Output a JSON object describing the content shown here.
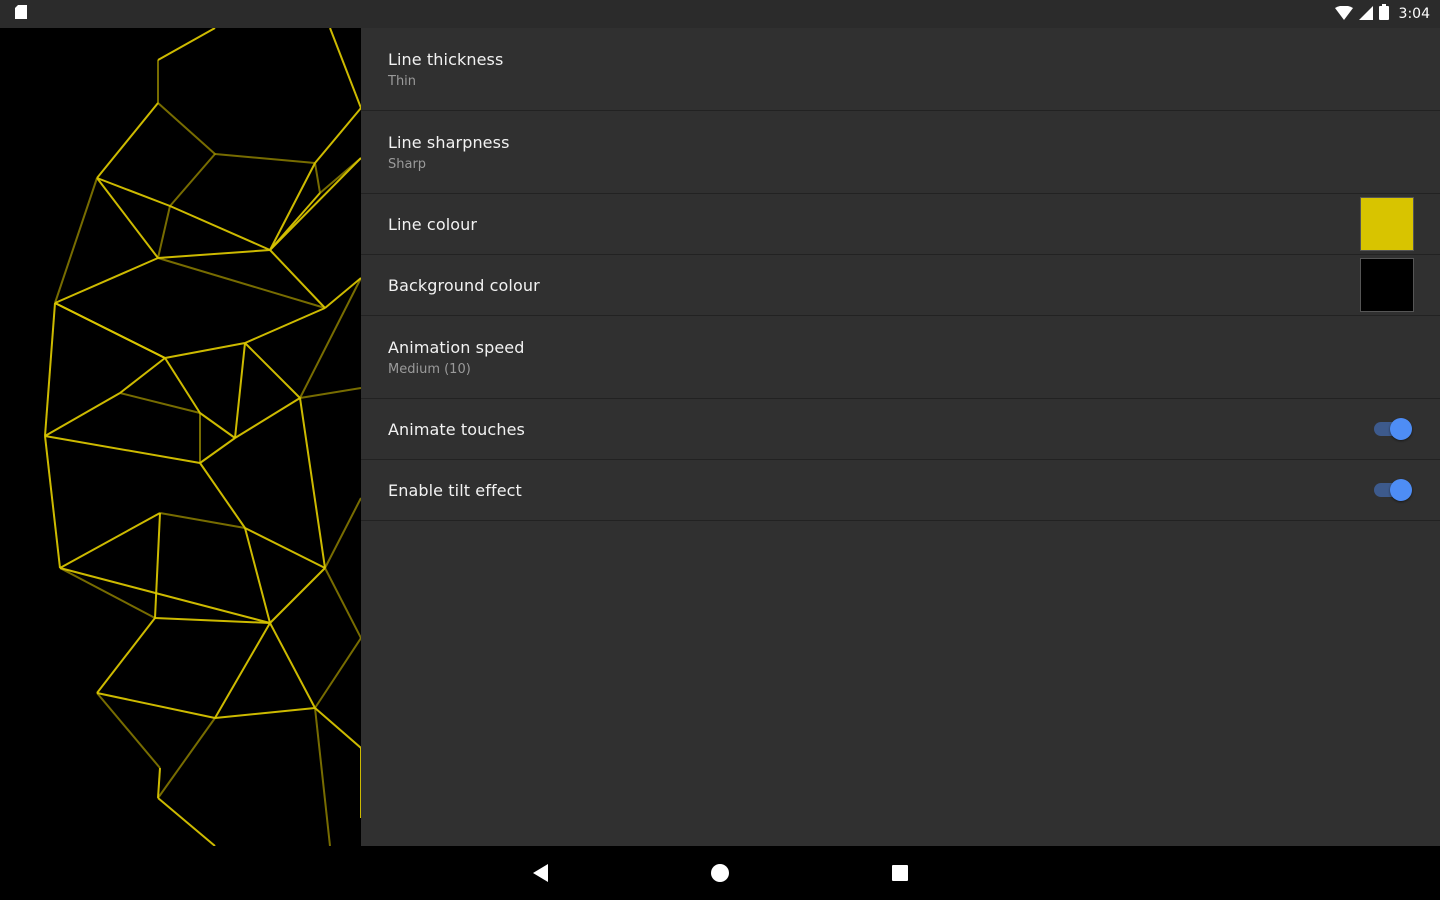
{
  "status_bar": {
    "time": "3:04",
    "icons": [
      "sd-card-icon",
      "wifi-icon",
      "cell-signal-icon",
      "battery-icon"
    ]
  },
  "preview": {
    "line_color": "#d8c400",
    "background_color": "#000000"
  },
  "settings": {
    "items": [
      {
        "title": "Line thickness",
        "summary": "Thin"
      },
      {
        "title": "Line sharpness",
        "summary": "Sharp"
      },
      {
        "title": "Line colour",
        "color": "#d8c400"
      },
      {
        "title": "Background colour",
        "color": "#000000"
      },
      {
        "title": "Animation speed",
        "summary": "Medium (10)"
      },
      {
        "title": "Animate touches",
        "enabled": true
      },
      {
        "title": "Enable tilt effect",
        "enabled": true
      }
    ]
  },
  "nav_bar": {
    "icons": [
      "back-icon",
      "home-icon",
      "recents-icon"
    ]
  },
  "colors": {
    "accent": "#4e8df5",
    "panel_bg": "#303030"
  }
}
